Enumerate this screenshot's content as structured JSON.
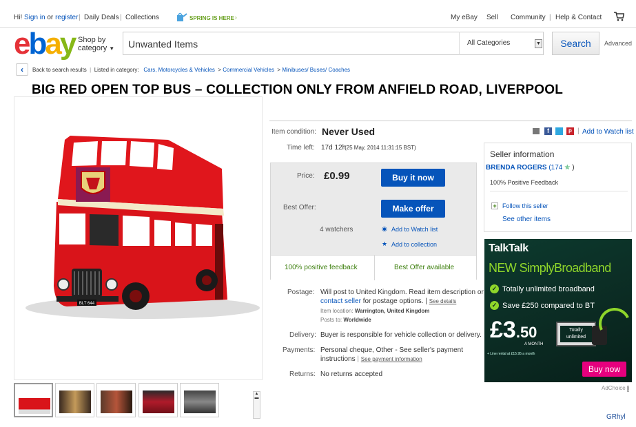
{
  "topbar": {
    "hi": "Hi!",
    "sign_in": "Sign in",
    "or": "or",
    "register": "register",
    "daily_deals": "Daily Deals",
    "collections": "Collections",
    "spring": "SPRING IS HERE",
    "my_ebay": "My eBay",
    "sell": "Sell",
    "community": "Community",
    "help": "Help & Contact"
  },
  "header": {
    "logo_letters": [
      "e",
      "b",
      "a",
      "y"
    ],
    "shop_by_1": "Shop by",
    "shop_by_2": "category",
    "search_value": "Unwanted Items",
    "category": "All Categories",
    "search_button": "Search",
    "advanced": "Advanced"
  },
  "breadcrumb": {
    "back": "Back to search results",
    "listed_in": "Listed in category:",
    "c1": "Cars, Motorcycles & Vehicles",
    "c2": "Commercial Vehicles",
    "c3": "Minibuses/ Buses/ Coaches"
  },
  "listing": {
    "title": "BIG RED OPEN TOP BUS  –  COLLECTION ONLY FROM ANFIELD ROAD, LIVERPOOL",
    "bus_plate": "BLT 644",
    "condition_label": "Item condition:",
    "condition": "Never Used",
    "time_left_label": "Time left:",
    "time_left": "17d 12h",
    "end_time": "(25 May, 2014  11:31:15 BST)",
    "add_watch_top": "Add to Watch list",
    "price_label": "Price:",
    "price": "£0.99",
    "buy_now": "Buy it now",
    "best_offer_label": "Best Offer:",
    "make_offer": "Make offer",
    "watchers": "4 watchers",
    "add_watch": "Add to Watch list",
    "add_collection": "Add to collection",
    "positive_feedback": "100% positive feedback",
    "best_offer_available": "Best Offer available",
    "postage_label": "Postage:",
    "postage_1": "Will post to United Kingdom. Read item description or",
    "contact_seller": "contact seller",
    "postage_2": "for postage options. |",
    "see_details": "See details",
    "item_location_label": "Item location:",
    "item_location": "Warrington, United Kingdom",
    "posts_to_label": "Posts to:",
    "posts_to": "Worldwide",
    "delivery_label": "Delivery:",
    "delivery": "Buyer is responsible for vehicle collection or delivery.",
    "payments_label": "Payments:",
    "payments_1": "Personal cheque,  Other - See seller's payment",
    "payments_2": "instructions",
    "see_payment": "See payment information",
    "returns_label": "Returns:",
    "returns": "No returns accepted"
  },
  "seller": {
    "heading": "Seller information",
    "name": "BRENDA ROGERS",
    "score": "(174",
    "score_close": ")",
    "feedback": "100% Positive Feedback",
    "follow": "Follow this seller",
    "other_items": "See other items"
  },
  "ad": {
    "brand": "TalkTalk",
    "headline_1": "NEW",
    "headline_2": "SimplyBroadband",
    "bullet_1": "Totally unlimited broadband",
    "bullet_2": "Save £250 compared to BT",
    "price_big": "£3",
    "price_small": ".50",
    "per": "A MONTH",
    "note": "+ Line rental at £15.95 a month",
    "box_1": "Totally",
    "box_2": "unlimited",
    "buy_now": "Buy now",
    "adchoice": "AdChoice"
  },
  "credit": "GRhyl",
  "colors": {
    "ebay_blue": "#0654ba",
    "bus_red": "#d9141a",
    "ad_green": "#7ed321",
    "ad_pink": "#e6007e"
  }
}
